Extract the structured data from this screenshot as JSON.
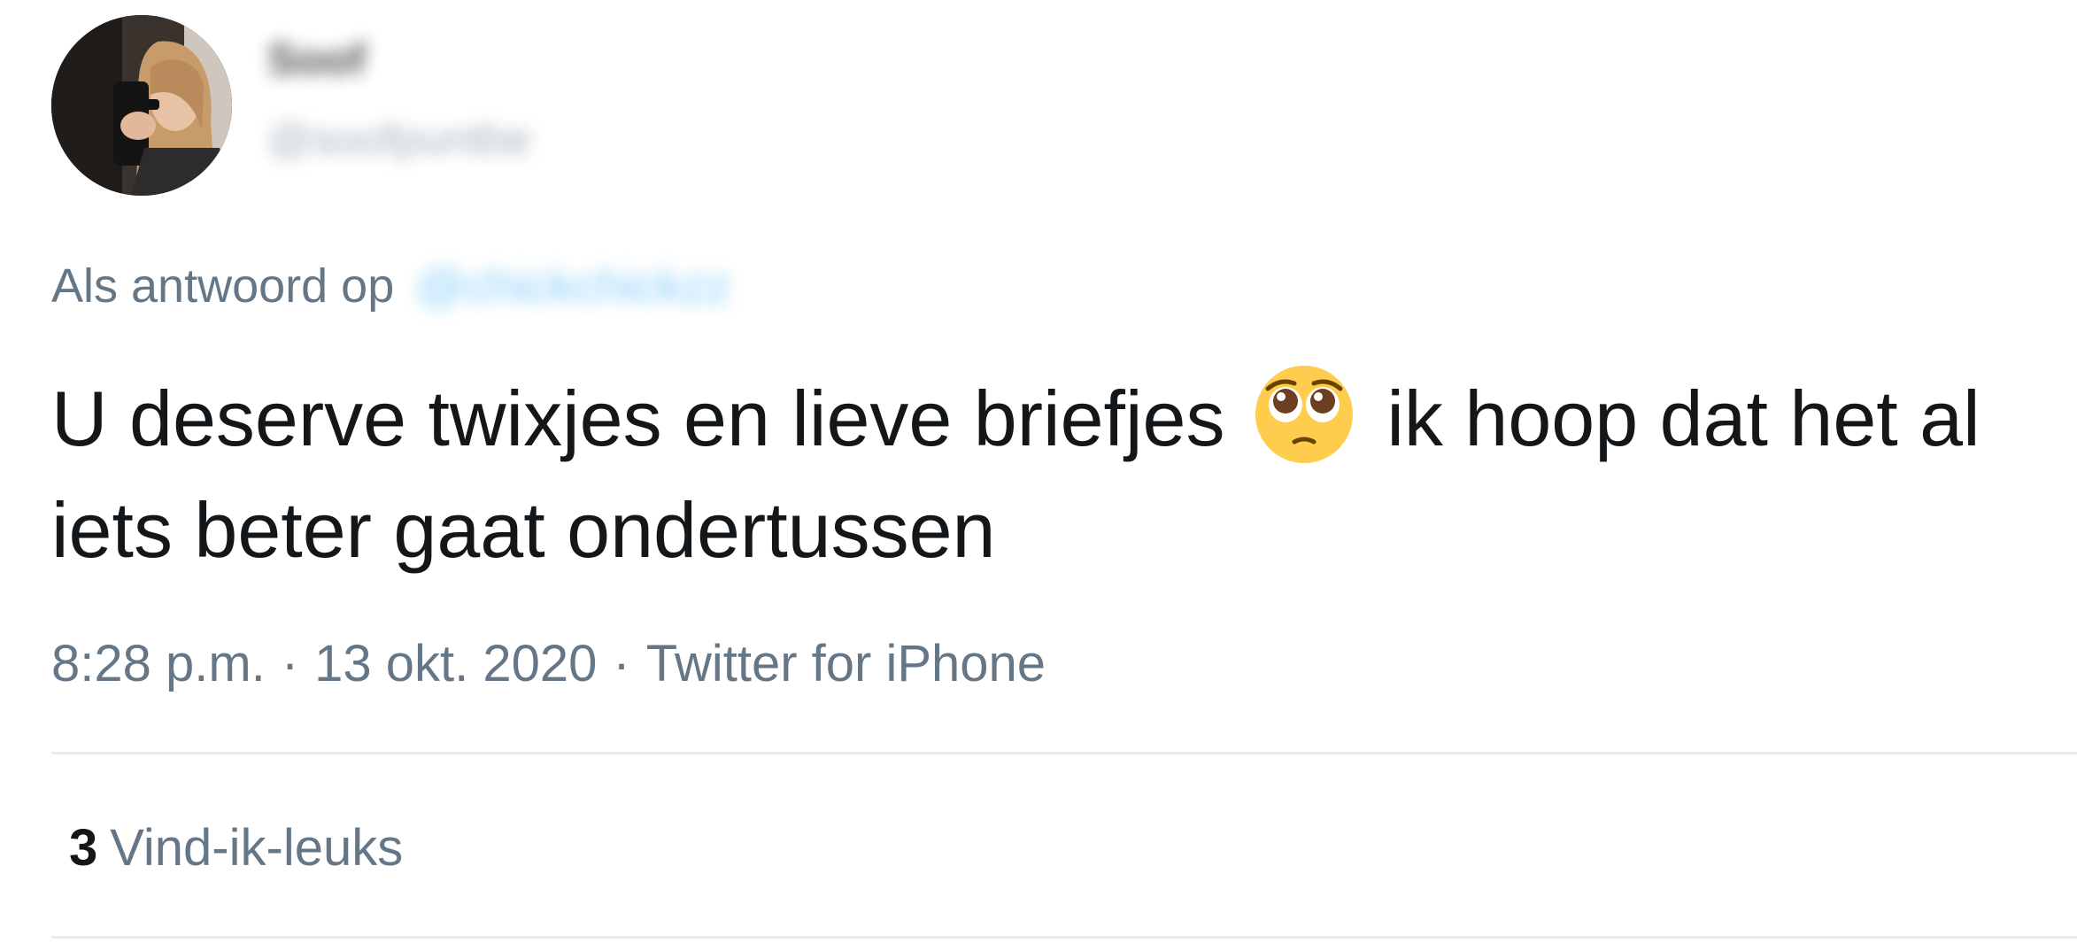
{
  "author": {
    "display_name": "Soof",
    "handle": "@soofpuntbe"
  },
  "reply": {
    "prefix": "Als antwoord op",
    "mention": "@chickchickzz"
  },
  "tweet": {
    "text_before_emoji": "U deserve twixjes en lieve briefjes",
    "emoji": "pleading-face-emoji",
    "text_after_emoji": "ik hoop dat het al iets beter gaat ondertussen"
  },
  "meta": {
    "time": "8:28 p.m.",
    "separator": "·",
    "date": "13 okt. 2020",
    "source": "Twitter for iPhone"
  },
  "engagement": {
    "likes_count": "3",
    "likes_label": "Vind-ik-leuks"
  },
  "colors": {
    "text_primary": "#14171a",
    "text_secondary": "#657786",
    "link": "#1da1f2",
    "divider": "#e6ecf0"
  }
}
